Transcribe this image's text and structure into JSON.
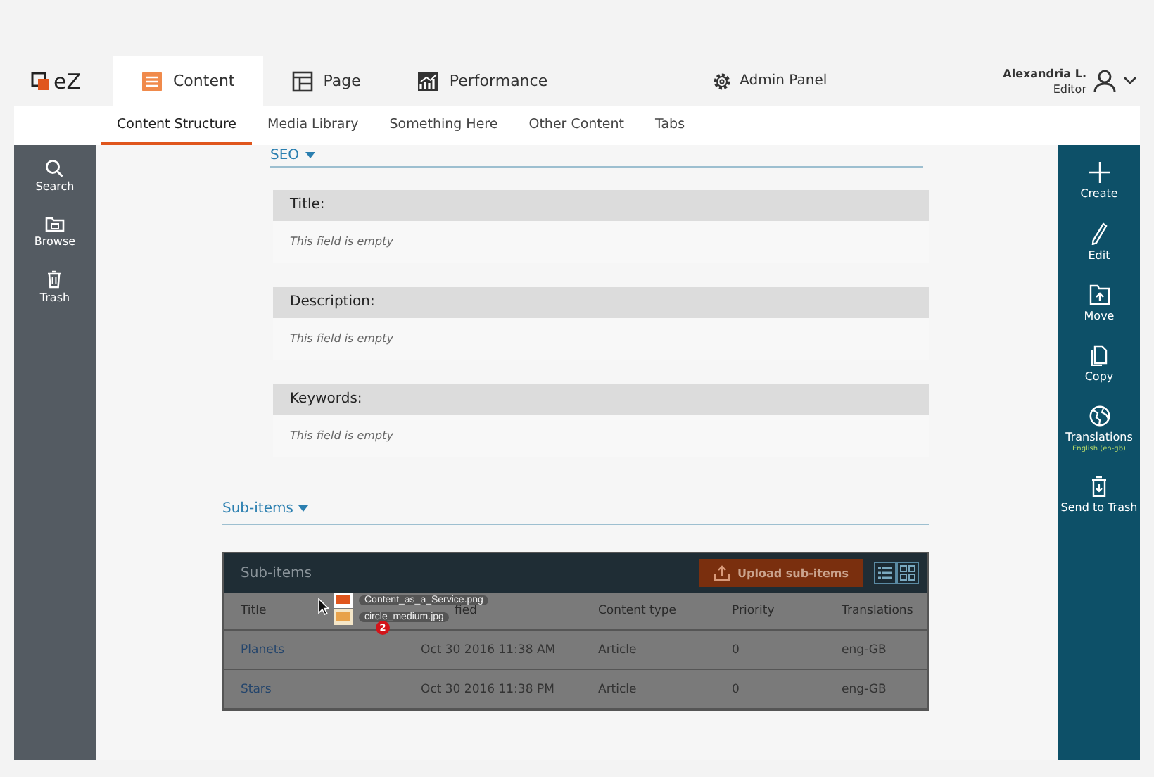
{
  "topnav": {
    "logo": "eZ",
    "tabs": [
      {
        "label": "Content",
        "selected": true
      },
      {
        "label": "Page",
        "selected": false
      },
      {
        "label": "Performance",
        "selected": false
      }
    ],
    "admin": "Admin Panel",
    "user": {
      "name": "Alexandria L.",
      "role": "Editor"
    }
  },
  "subnav": [
    {
      "label": "Content Structure",
      "selected": true
    },
    {
      "label": "Media Library",
      "selected": false
    },
    {
      "label": "Something Here",
      "selected": false
    },
    {
      "label": "Other Content",
      "selected": false
    },
    {
      "label": "Tabs",
      "selected": false
    }
  ],
  "left_sidebar": [
    {
      "label": "Search"
    },
    {
      "label": "Browse"
    },
    {
      "label": "Trash"
    }
  ],
  "seo": {
    "heading": "SEO",
    "fields": [
      {
        "label": "Title:",
        "value": "This field is empty"
      },
      {
        "label": "Description:",
        "value": "This field is empty"
      },
      {
        "label": "Keywords:",
        "value": "This field is empty"
      }
    ]
  },
  "subitems": {
    "heading": "Sub-items",
    "panel_title": "Sub-items",
    "upload": "Upload sub-items",
    "columns": [
      "Title",
      "fied",
      "Content type",
      "Priority",
      "Translations"
    ],
    "rows": [
      {
        "title": "Planets",
        "modified": "Oct 30 2016 11:38 AM",
        "type": "Article",
        "priority": "0",
        "translations": "eng-GB"
      },
      {
        "title": "Stars",
        "modified": "Oct 30 2016 11:38 PM",
        "type": "Article",
        "priority": "0",
        "translations": "eng-GB"
      }
    ],
    "drag": {
      "files": [
        "Content_as_a_Service.png",
        "circle_medium.jpg"
      ],
      "count": "2"
    }
  },
  "right_sidebar": [
    {
      "label": "Create"
    },
    {
      "label": "Edit"
    },
    {
      "label": "Move"
    },
    {
      "label": "Copy"
    },
    {
      "label": "Translations",
      "sub": "English (en-gb)"
    },
    {
      "label": "Send to Trash"
    }
  ]
}
